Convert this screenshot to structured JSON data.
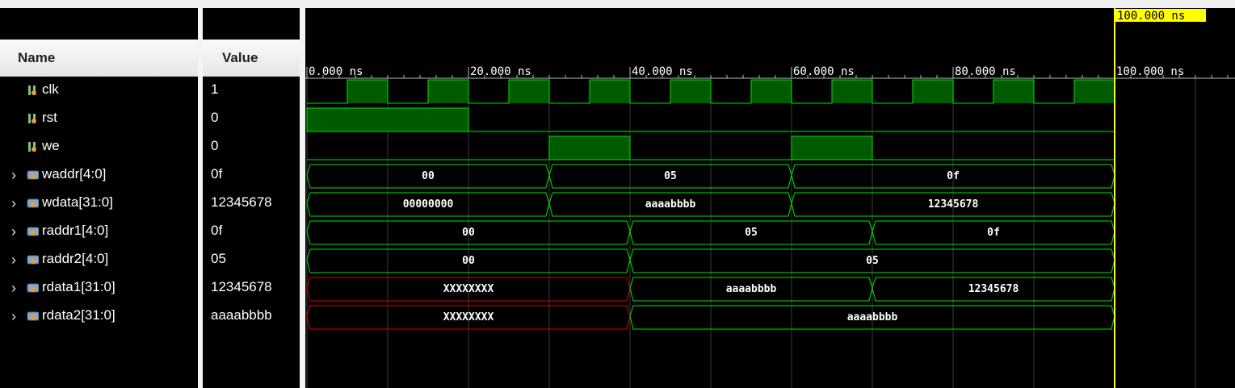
{
  "columns": {
    "name": "Name",
    "value": "Value"
  },
  "cursor_label": "100.000 ns",
  "timeline": {
    "tick_labels": [
      "0.000 ns",
      "20.000 ns",
      "40.000 ns",
      "60.000 ns",
      "80.000 ns",
      "100.000 ns"
    ]
  },
  "signals": [
    {
      "name": "clk",
      "value": "1",
      "type": "bit",
      "expandable": false
    },
    {
      "name": "rst",
      "value": "0",
      "type": "bit",
      "expandable": false
    },
    {
      "name": "we",
      "value": "0",
      "type": "bit",
      "expandable": false
    },
    {
      "name": "waddr[4:0]",
      "value": "0f",
      "type": "bus",
      "expandable": true
    },
    {
      "name": "wdata[31:0]",
      "value": "12345678",
      "type": "bus",
      "expandable": true
    },
    {
      "name": "raddr1[4:0]",
      "value": "0f",
      "type": "bus",
      "expandable": true
    },
    {
      "name": "raddr2[4:0]",
      "value": "05",
      "type": "bus",
      "expandable": true
    },
    {
      "name": "rdata1[31:0]",
      "value": "12345678",
      "type": "bus",
      "expandable": true
    },
    {
      "name": "rdata2[31:0]",
      "value": "aaaabbbb",
      "type": "bus",
      "expandable": true
    }
  ],
  "waveforms": {
    "clk": {
      "period_ns": 10,
      "high_start_ns": 5
    },
    "rst": [
      {
        "from": 0,
        "to": 20,
        "level": 1
      },
      {
        "from": 20,
        "to": 100,
        "level": 0
      }
    ],
    "we": [
      {
        "from": 0,
        "to": 30,
        "level": 0
      },
      {
        "from": 30,
        "to": 40,
        "level": 1
      },
      {
        "from": 40,
        "to": 60,
        "level": 0
      },
      {
        "from": 60,
        "to": 70,
        "level": 1
      },
      {
        "from": 70,
        "to": 100,
        "level": 0
      }
    ],
    "waddr[4:0]": [
      {
        "from": 0,
        "to": 30,
        "label": "00"
      },
      {
        "from": 30,
        "to": 60,
        "label": "05"
      },
      {
        "from": 60,
        "to": 100,
        "label": "0f"
      }
    ],
    "wdata[31:0]": [
      {
        "from": 0,
        "to": 30,
        "label": "00000000"
      },
      {
        "from": 30,
        "to": 60,
        "label": "aaaabbbb"
      },
      {
        "from": 60,
        "to": 100,
        "label": "12345678"
      }
    ],
    "raddr1[4:0]": [
      {
        "from": 0,
        "to": 40,
        "label": "00"
      },
      {
        "from": 40,
        "to": 70,
        "label": "05"
      },
      {
        "from": 70,
        "to": 100,
        "label": "0f"
      }
    ],
    "raddr2[4:0]": [
      {
        "from": 0,
        "to": 40,
        "label": "00"
      },
      {
        "from": 40,
        "to": 100,
        "label": "05"
      }
    ],
    "rdata1[31:0]": [
      {
        "from": 0,
        "to": 40,
        "label": "XXXXXXXX",
        "unknown": true
      },
      {
        "from": 40,
        "to": 70,
        "label": "aaaabbbb"
      },
      {
        "from": 70,
        "to": 100,
        "label": "12345678"
      }
    ],
    "rdata2[31:0]": [
      {
        "from": 0,
        "to": 40,
        "label": "XXXXXXXX",
        "unknown": true
      },
      {
        "from": 40,
        "to": 100,
        "label": "aaaabbbb"
      }
    ]
  },
  "colors": {
    "background": "#000000",
    "wave": "#00e400",
    "wave_fill": "#005a00",
    "unknown": "#e00000",
    "cursor": "#ffff00",
    "grid": "#3a3a3a",
    "text": "#ffffff"
  }
}
